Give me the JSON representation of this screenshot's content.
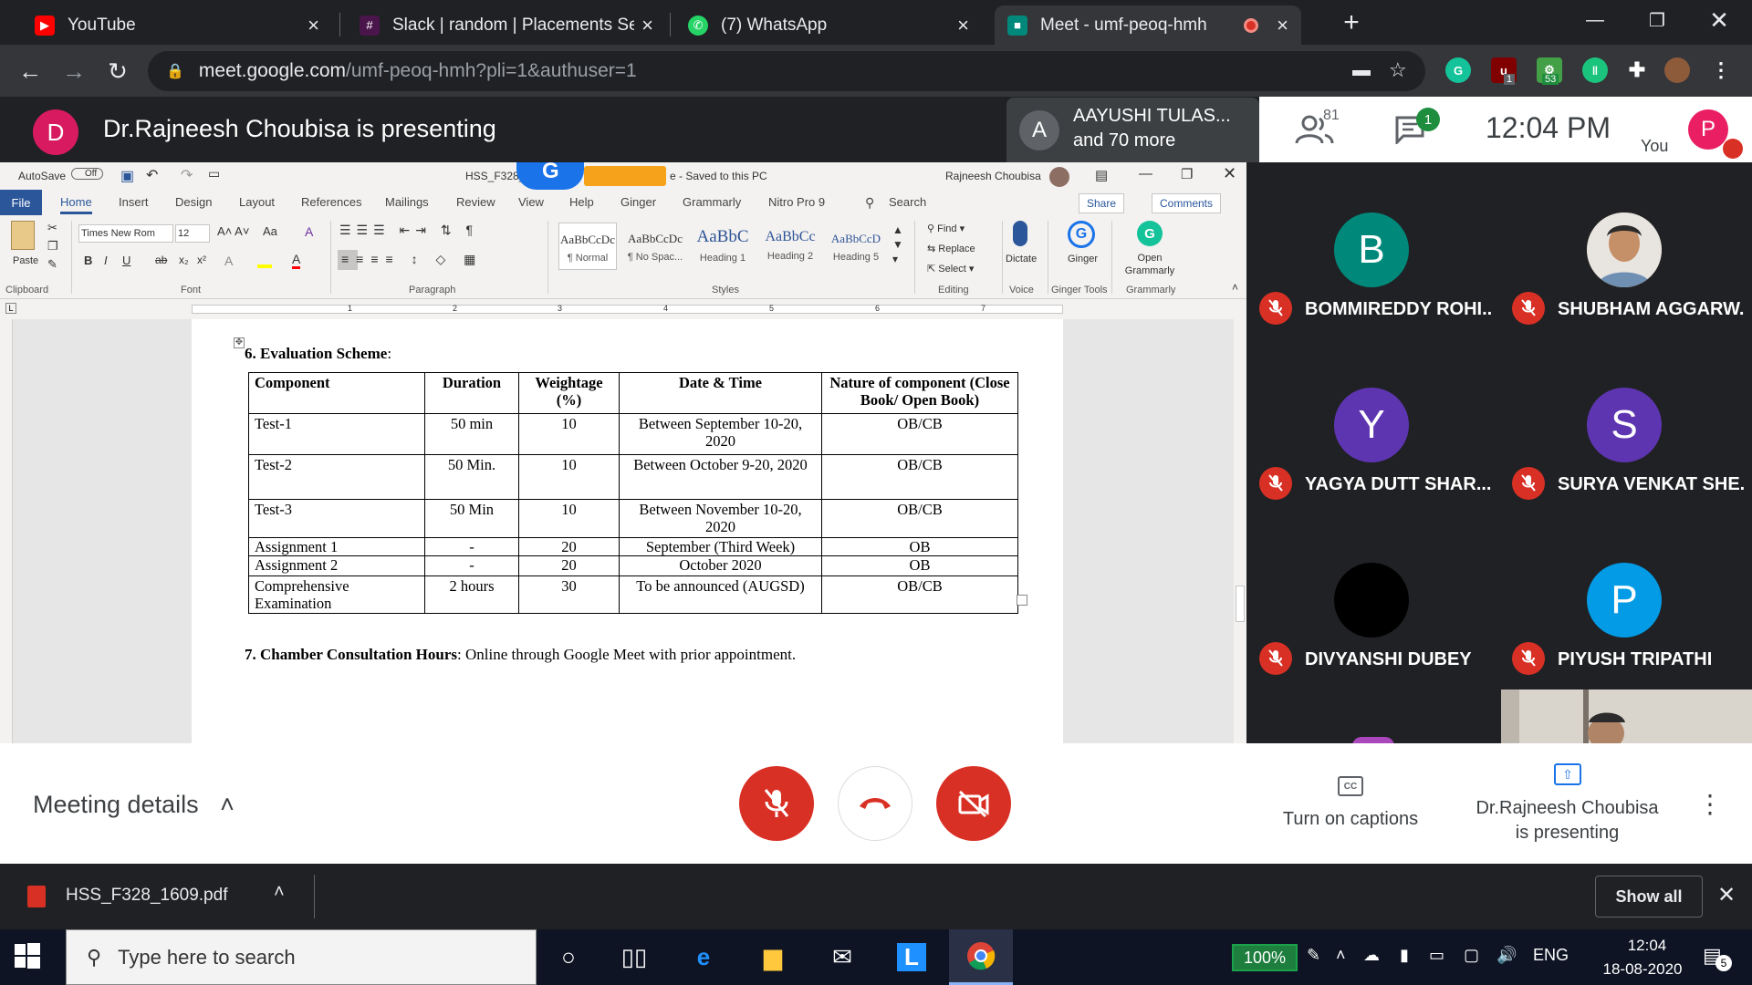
{
  "browser": {
    "tabs": [
      {
        "title": "YouTube",
        "fav_color": "#ff0000",
        "fav_icon": "youtube-icon"
      },
      {
        "title": "Slack | random | Placements Sem",
        "fav_color": "#4a154b",
        "fav_icon": "slack-icon"
      },
      {
        "title": "(7) WhatsApp",
        "fav_color": "#25d366",
        "fav_icon": "whatsapp-icon"
      },
      {
        "title": "Meet - umf-peoq-hmh",
        "fav_color": "#00897b",
        "fav_icon": "meet-icon"
      }
    ],
    "url_host": "meet.google.com",
    "url_path": "/umf-peoq-hmh?pli=1&authuser=1",
    "ext_badges": {
      "ublock": "1",
      "ext_53": "53"
    }
  },
  "meet": {
    "presenter_initial": "D",
    "presenter_text": "Dr.Rajneesh Choubisa is presenting",
    "viewer_initial": "A",
    "viewer_name": "AAYUSHI TULAS...",
    "viewer_more": "and 70 more",
    "people_count": "81",
    "chat_badge": "1",
    "time": "12:04  PM",
    "you_label": "You",
    "you_initial": "P",
    "participants": [
      {
        "initial": "B",
        "name": "BOMMIREDDY ROHI...",
        "color": "#00897b"
      },
      {
        "initial": "",
        "name": "SHUBHAM AGGARW...",
        "color": "#c9a27f"
      },
      {
        "initial": "Y",
        "name": "YAGYA DUTT SHAR...",
        "color": "#5e35b1"
      },
      {
        "initial": "S",
        "name": "SURYA VENKAT SHE...",
        "color": "#5e35b1"
      },
      {
        "initial": "",
        "name": "DIVYANSHI DUBEY",
        "color": "#000000"
      },
      {
        "initial": "P",
        "name": "PIYUSH TRIPATHI",
        "color": "#039be5"
      }
    ],
    "meeting_details": "Meeting details",
    "captions": "Turn on captions",
    "presenting_label_1": "Dr.Rajneesh Choubisa",
    "presenting_label_2": "is presenting"
  },
  "word": {
    "autosave": "AutoSave",
    "autosave_state": "Off",
    "doc_name": "HSS_F328_1",
    "saved": "e  -  Saved to this PC",
    "user": "Rajneesh Choubisa",
    "tabs": [
      "File",
      "Home",
      "Insert",
      "Design",
      "Layout",
      "References",
      "Mailings",
      "Review",
      "View",
      "Help",
      "Ginger",
      "Grammarly",
      "Nitro Pro 9"
    ],
    "search": "Search",
    "share": "Share",
    "comments": "Comments",
    "font_name": "Times New Rom",
    "font_size": "12",
    "paste": "Paste",
    "styles": [
      {
        "sample": "AaBbCcDc",
        "name": "¶ Normal"
      },
      {
        "sample": "AaBbCcDc",
        "name": "¶ No Spac..."
      },
      {
        "sample": "AaBbC",
        "name": "Heading 1"
      },
      {
        "sample": "AaBbCc",
        "name": "Heading 2"
      },
      {
        "sample": "AaBbCcD",
        "name": "Heading 5"
      }
    ],
    "editing": {
      "find": "Find",
      "replace": "Replace",
      "select": "Select"
    },
    "dictate": "Dictate",
    "ginger": "Ginger",
    "open_grammarly": "Open Grammarly",
    "groups": [
      "Clipboard",
      "Font",
      "Paragraph",
      "Styles",
      "Editing",
      "Voice",
      "Ginger Tools",
      "Grammarly"
    ],
    "ruler_ticks": [
      "1",
      "2",
      "3",
      "4",
      "5",
      "6",
      "7"
    ],
    "heading_6_num": "6. ",
    "heading_6": "Evaluation Scheme",
    "heading_6_colon": ":",
    "table": {
      "headers": [
        "Component",
        "Duration",
        "Weightage (%)",
        "Date & Time",
        "Nature of component (Close Book/ Open Book)"
      ],
      "rows": [
        [
          "Test-1",
          "50 min",
          "10",
          "Between September 10-20, 2020",
          "OB/CB"
        ],
        [
          "Test-2",
          "50 Min.",
          "10",
          "Between October 9-20, 2020",
          "OB/CB"
        ],
        [
          "Test-3",
          "50 Min",
          "10",
          "Between November 10-20, 2020",
          "OB/CB"
        ],
        [
          "Assignment 1",
          "-",
          "20",
          "September (Third Week)",
          "OB"
        ],
        [
          "Assignment 2",
          "-",
          "20",
          "October 2020",
          "OB"
        ],
        [
          "Comprehensive Examination",
          "2 hours",
          "30",
          "To be announced (AUGSD)",
          "OB/CB"
        ]
      ]
    },
    "heading_7_bold": "7. Chamber Consultation Hours",
    "heading_7_rest": ": Online through Google Meet with prior appointment."
  },
  "downloads": {
    "file": "HSS_F328_1609.pdf",
    "show_all": "Show all"
  },
  "taskbar": {
    "search_placeholder": "Type here to search",
    "battery": "100%",
    "lang": "ENG",
    "time": "12:04",
    "date": "18-08-2020",
    "notifications": "5"
  }
}
